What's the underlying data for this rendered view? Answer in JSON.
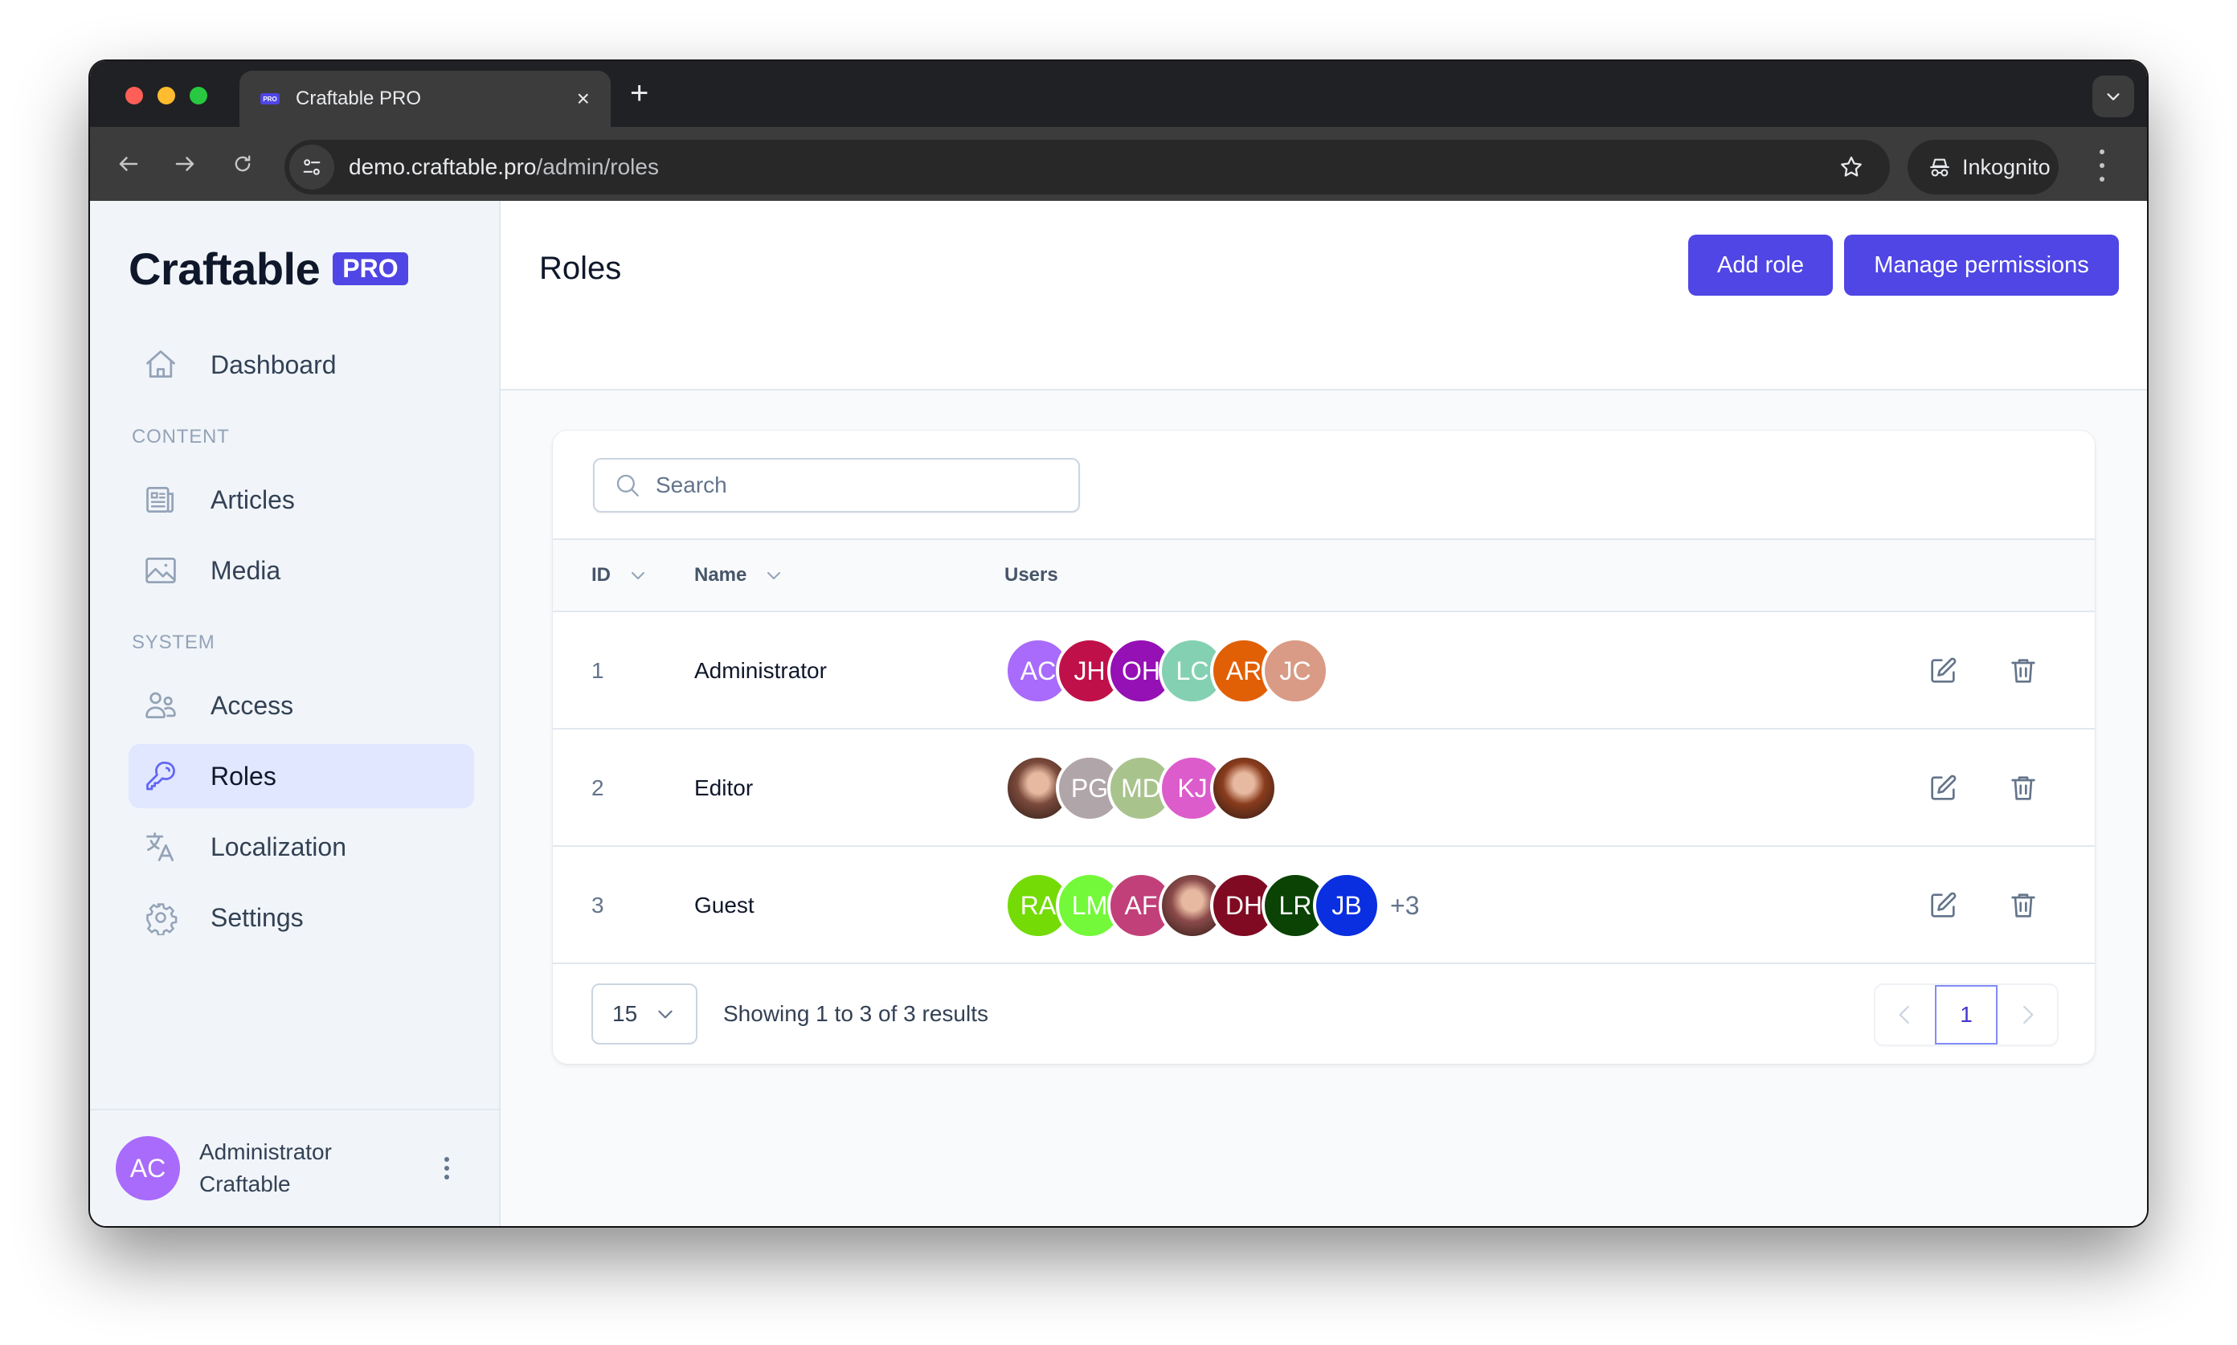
{
  "browser": {
    "tab_title": "Craftable PRO",
    "tab_favicon_text": "PRO",
    "url_host": "demo.craftable.pro",
    "url_path": "/admin/roles",
    "profile_label": "Inkognito"
  },
  "sidebar": {
    "logo_text": "Craftable",
    "logo_badge": "PRO",
    "items": [
      {
        "label": "Dashboard",
        "icon": "home-icon"
      },
      {
        "label": "Articles",
        "icon": "newspaper-icon"
      },
      {
        "label": "Media",
        "icon": "image-icon"
      },
      {
        "label": "Access",
        "icon": "users-icon"
      },
      {
        "label": "Roles",
        "icon": "key-icon",
        "active": true
      },
      {
        "label": "Localization",
        "icon": "translate-icon"
      },
      {
        "label": "Settings",
        "icon": "gear-icon"
      }
    ],
    "sections": {
      "content": "CONTENT",
      "system": "SYSTEM"
    },
    "user": {
      "initials": "AC",
      "name": "Administrator",
      "org": "Craftable"
    }
  },
  "header": {
    "title": "Roles",
    "add_role_label": "Add role",
    "manage_permissions_label": "Manage permissions"
  },
  "search": {
    "placeholder": "Search",
    "value": ""
  },
  "table": {
    "columns": {
      "id": "ID",
      "name": "Name",
      "users": "Users"
    },
    "rows": [
      {
        "id": "1",
        "name": "Administrator",
        "users": [
          {
            "initials": "AC",
            "color": "#a86bfb"
          },
          {
            "initials": "JH",
            "color": "#c0104a"
          },
          {
            "initials": "OH",
            "color": "#9510b5"
          },
          {
            "initials": "LC",
            "color": "#83d1b2"
          },
          {
            "initials": "AR",
            "color": "#e16005"
          },
          {
            "initials": "JC",
            "color": "#d99b86"
          }
        ],
        "more": ""
      },
      {
        "id": "2",
        "name": "Editor",
        "users": [
          {
            "initials": "",
            "photo": true,
            "color": "#7b4a3c"
          },
          {
            "initials": "PG",
            "color": "#b0a5a8"
          },
          {
            "initials": "MD",
            "color": "#a9c38d"
          },
          {
            "initials": "KJ",
            "color": "#dc5ccb"
          },
          {
            "initials": "",
            "photo": true,
            "color": "#8a3c1d"
          }
        ],
        "more": ""
      },
      {
        "id": "3",
        "name": "Guest",
        "users": [
          {
            "initials": "RA",
            "color": "#74db06"
          },
          {
            "initials": "LM",
            "color": "#73f93a"
          },
          {
            "initials": "AF",
            "color": "#c14079"
          },
          {
            "initials": "",
            "photo": true,
            "color": "#8b4a4a"
          },
          {
            "initials": "DH",
            "color": "#800a22"
          },
          {
            "initials": "LR",
            "color": "#0a4304"
          },
          {
            "initials": "JB",
            "color": "#0a2fe0"
          }
        ],
        "more": "+3"
      }
    ]
  },
  "footer": {
    "per_page": "15",
    "showing_text": "Showing 1 to 3 of 3 results",
    "current_page": "1"
  },
  "colors": {
    "accent": "#4f46e5",
    "active_nav_bg": "#e0e7ff"
  }
}
